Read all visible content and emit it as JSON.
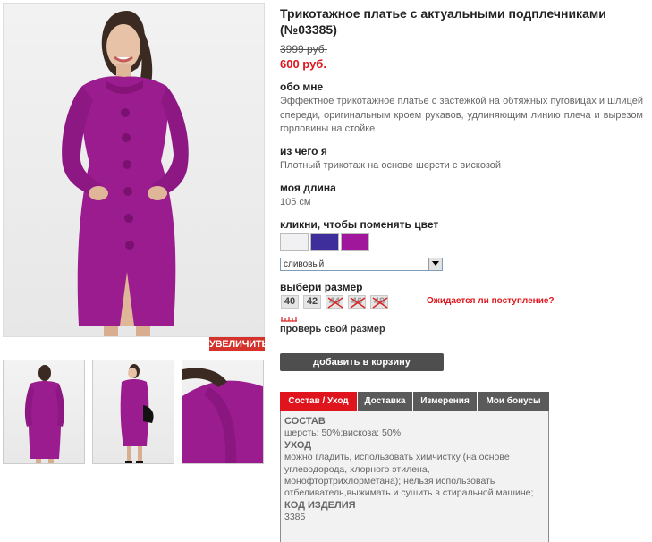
{
  "product": {
    "title": "Трикотажное платье с актуальными подплечниками (№03385)",
    "old_price": "3999 руб.",
    "new_price": "600 руб."
  },
  "gallery": {
    "zoom_label": "УВЕЛИЧИТЬ",
    "dress_color": "#9b1c8e"
  },
  "about": {
    "heading": "обо мне",
    "text": "Эффектное трикотажное платье с застежкой на обтяжных пуговицах и шлицей спереди, оригинальным кроем рукавов, удлиняющим линию плеча и вырезом горловины на стойке"
  },
  "material": {
    "heading": "из чего я",
    "text": "Плотный трикотаж на основе шерсти с вискозой"
  },
  "length": {
    "heading": "моя длина",
    "text": "105 см"
  },
  "colors": {
    "heading": "кликни, чтобы поменять цвет",
    "swatches": [
      {
        "name": "white",
        "color": "#f1f1f4"
      },
      {
        "name": "blue",
        "color": "#3d2e9c"
      },
      {
        "name": "plum",
        "color": "#a1179b"
      }
    ],
    "selected": "сливовый"
  },
  "sizes": {
    "heading": "выбери размер",
    "options": [
      {
        "label": "40",
        "available": true
      },
      {
        "label": "42",
        "available": true
      },
      {
        "label": "44",
        "available": false
      },
      {
        "label": "46",
        "available": false
      },
      {
        "label": "48",
        "available": false
      }
    ],
    "notify_link": "Ожидается ли поступление?",
    "check_size_link": "проверь свой размер"
  },
  "cart": {
    "add_label": "добавить в корзину"
  },
  "tabs": {
    "items": [
      {
        "label": "Состав / Уход",
        "active": true
      },
      {
        "label": "Доставка",
        "active": false
      },
      {
        "label": "Измерения",
        "active": false
      },
      {
        "label": "Мои бонусы",
        "active": false
      }
    ],
    "panel": {
      "composition_heading": "СОСТАВ",
      "composition_text": "шерсть: 50%;вискоза: 50%",
      "care_heading": "УХОД",
      "care_text": "можно гладить, использовать химчистку (на основе углеводорода, хлорного этилена, монофтортрихлорметана); нельзя использовать отбеливатель,выжимать и сушить в стиральной машине;",
      "code_heading": "КОД ИЗДЕЛИЯ",
      "code_text": "3385"
    }
  },
  "accent_red": "#e0141c"
}
